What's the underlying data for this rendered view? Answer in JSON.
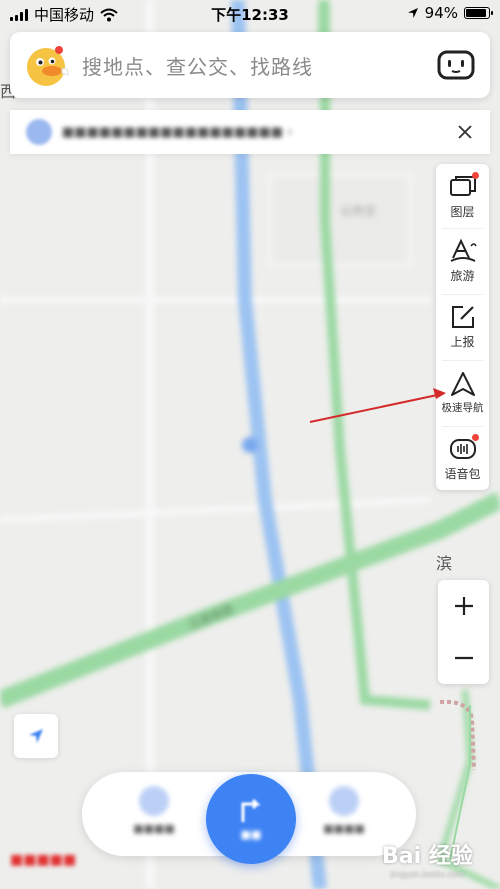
{
  "status_bar": {
    "carrier": "中国移动",
    "time": "下午12:33",
    "battery": "94%",
    "battery_level": 0.94
  },
  "search": {
    "placeholder": "搜地点、查公交、找路线"
  },
  "toolbar": {
    "items": [
      {
        "label": "图层",
        "icon": "layers-icon",
        "badge": true
      },
      {
        "label": "旅游",
        "icon": "travel-icon",
        "badge": false
      },
      {
        "label": "上报",
        "icon": "report-icon",
        "badge": false
      },
      {
        "label": "极速导航",
        "icon": "navigation-arrow-icon",
        "badge": false
      },
      {
        "label": "语音包",
        "icon": "voice-pack-icon",
        "badge": true
      }
    ]
  },
  "zoom": {
    "in_label": "+",
    "out_label": "−"
  },
  "map": {
    "labels": {
      "top_left": "西",
      "right_area": "滨"
    },
    "colors": {
      "road_blue": "#9cc3f2",
      "road_green": "#9bd9a3",
      "background": "#eeeeec"
    }
  },
  "annotation": {
    "arrow_color": "#d42a2a"
  },
  "nav": {
    "accent": "#3e83f4"
  },
  "watermark": {
    "text": "Bai 经验",
    "sub": "jingyan.baidu.com"
  }
}
